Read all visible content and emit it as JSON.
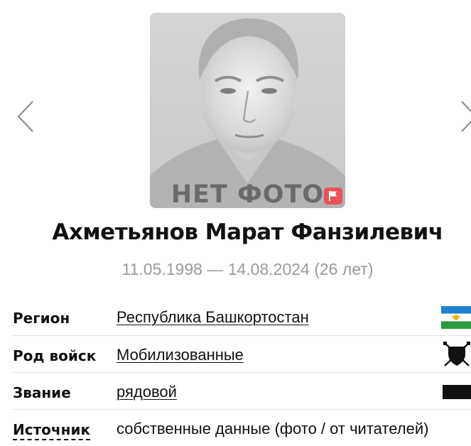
{
  "photo": {
    "placeholder_text": "НЕТ ФОТО",
    "placeholder_bg": "#cfcfcf",
    "badge_color": "#e8525a",
    "badge_icon": "flag-icon"
  },
  "carousel": {
    "prev_icon": "chevron-left-icon",
    "next_icon": "chevron-right-icon"
  },
  "person": {
    "name": "Ахметьянов Марат Фанзилевич",
    "dates": "11.05.1998 — 14.08.2024 (26 лет)"
  },
  "details": [
    {
      "label": "Регион",
      "value": "Республика Башкортостан",
      "is_link": true,
      "icon": "bashkortostan-flag-icon"
    },
    {
      "label": "Род войск",
      "value": "Мобилизованные",
      "is_link": true,
      "icon": "shield-swords-icon"
    },
    {
      "label": "Звание",
      "value": "рядовой",
      "is_link": true,
      "icon": "rank-stripe-icon"
    },
    {
      "label": "Источник",
      "value": "собственные данные (фото / от читателей)",
      "is_link": false,
      "icon": null
    }
  ],
  "colors": {
    "text": "#111111",
    "muted": "#9a9a9a",
    "divider": "#e4e4e4",
    "flag_blue": "#1f7fd0",
    "flag_white": "#ffffff",
    "flag_green": "#2d9a3c"
  }
}
